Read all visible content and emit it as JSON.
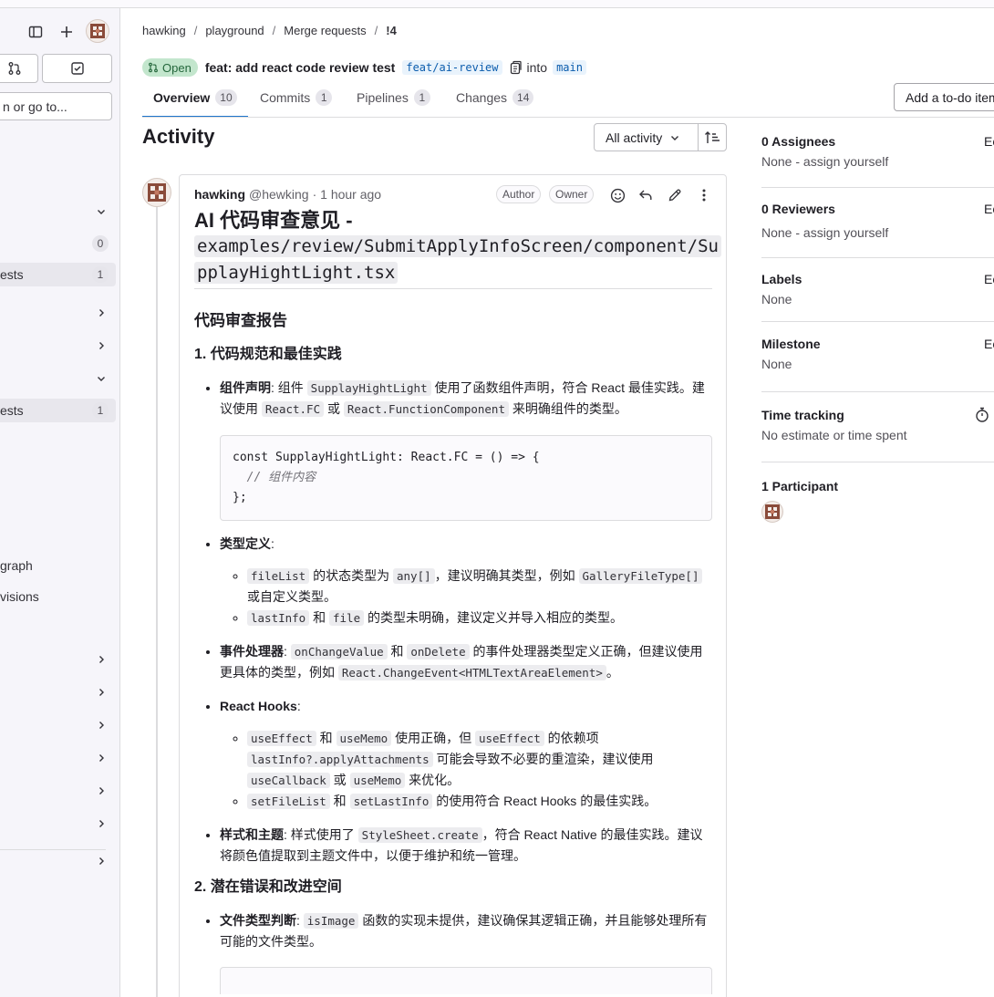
{
  "sidebar": {
    "search_label": "n or go to...",
    "rows": [
      {
        "label": "",
        "count": "0"
      },
      {
        "label": "ests",
        "count": "1"
      },
      {
        "label": "ests",
        "count": "1"
      },
      {
        "label": "graph"
      },
      {
        "label": "visions"
      }
    ]
  },
  "breadcrumbs": [
    "hawking",
    "playground",
    "Merge requests",
    "!4"
  ],
  "mr": {
    "state": "Open",
    "title": "feat: add react code review test",
    "source_branch": "feat/ai-review",
    "into_label": "into",
    "target_branch": "main"
  },
  "tabs": [
    {
      "label": "Overview",
      "count": "10"
    },
    {
      "label": "Commits",
      "count": "1"
    },
    {
      "label": "Pipelines",
      "count": "1"
    },
    {
      "label": "Changes",
      "count": "14"
    }
  ],
  "todo_button": "Add a to-do item",
  "activity": {
    "title": "Activity",
    "filter_label": "All activity"
  },
  "note": {
    "author": "hawking",
    "username": "@hewking",
    "time": "· 1 hour ago",
    "roles": [
      "Author",
      "Owner"
    ],
    "heading_text": "AI 代码审查意见 -",
    "heading_path_1": "examples/review/SubmitApplyInfoScreen/component/Su",
    "heading_path_2": "pplayHightLight.tsx",
    "h2": "代码审查报告",
    "sec1": "1. 代码规范和最佳实践",
    "sec2": "2. 潜在错误和改进空间",
    "b1_label": "组件声明",
    "b1_t1": ": 组件 ",
    "b1_c1": "SupplayHightLight",
    "b1_t2": " 使用了函数组件声明，符合 React 最佳实践。建议使用 ",
    "b1_c2": "React.FC",
    "b1_t3": " 或 ",
    "b1_c3": "React.FunctionComponent",
    "b1_t4": " 来明确组件的类型。",
    "code1_l1": "const SupplayHightLight: React.FC = () => {",
    "code1_l2": "  // 组件内容",
    "code1_l3": "};",
    "b2_label": "类型定义",
    "b2_colon": ":",
    "b2_s1_c1": "fileList",
    "b2_s1_t1": " 的状态类型为 ",
    "b2_s1_c2": "any[]",
    "b2_s1_t2": "，建议明确其类型，例如 ",
    "b2_s1_c3": "GalleryFileType[]",
    "b2_s1_t3": " 或自定义类型。",
    "b2_s2_c1": "lastInfo",
    "b2_s2_t1": " 和 ",
    "b2_s2_c2": "file",
    "b2_s2_t2": " 的类型未明确，建议定义并导入相应的类型。",
    "b3_label": "事件处理器",
    "b3_t1": ": ",
    "b3_c1": "onChangeValue",
    "b3_t2": " 和 ",
    "b3_c2": "onDelete",
    "b3_t3": " 的事件处理器类型定义正确，但建议使用更具体的类型，例如 ",
    "b3_c3": "React.ChangeEvent<HTMLTextAreaElement>",
    "b3_t4": "。",
    "b4_label": "React Hooks",
    "b4_colon": ":",
    "b4_s1_c1": "useEffect",
    "b4_s1_t1": " 和 ",
    "b4_s1_c2": "useMemo",
    "b4_s1_t2": " 使用正确，但 ",
    "b4_s1_c3": "useEffect",
    "b4_s1_t3": " 的依赖项 ",
    "b4_s1_c4": "lastInfo?.applyAttachments",
    "b4_s1_t4": " 可能会导致不必要的重渲染，建议使用 ",
    "b4_s1_c5": "useCallback",
    "b4_s1_t5": " 或 ",
    "b4_s1_c6": "useMemo",
    "b4_s1_t6": " 来优化。",
    "b4_s2_c1": "setFileList",
    "b4_s2_t1": " 和 ",
    "b4_s2_c2": "setLastInfo",
    "b4_s2_t2": " 的使用符合 React Hooks 的最佳实践。",
    "b5_label": "样式和主题",
    "b5_t1": ": 样式使用了 ",
    "b5_c1": "StyleSheet.create",
    "b5_t2": "，符合 React Native 的最佳实践。建议将颜色值提取到主题文件中，以便于维护和统一管理。",
    "b6_label": "文件类型判断",
    "b6_t1": ": ",
    "b6_c1": "isImage",
    "b6_t2": " 函数的实现未提供，建议确保其逻辑正确，并且能够处理所有可能的文件类型。"
  },
  "right": {
    "assignees_title": "0 Assignees",
    "assignees_value": "None - assign yourself",
    "reviewers_title": "0 Reviewers",
    "reviewers_value": "None - assign yourself",
    "labels_title": "Labels",
    "labels_value": "None",
    "milestone_title": "Milestone",
    "milestone_value": "None",
    "time_title": "Time tracking",
    "time_value": "No estimate or time spent",
    "participants_title": "1 Participant",
    "edit_label": "Ec"
  }
}
